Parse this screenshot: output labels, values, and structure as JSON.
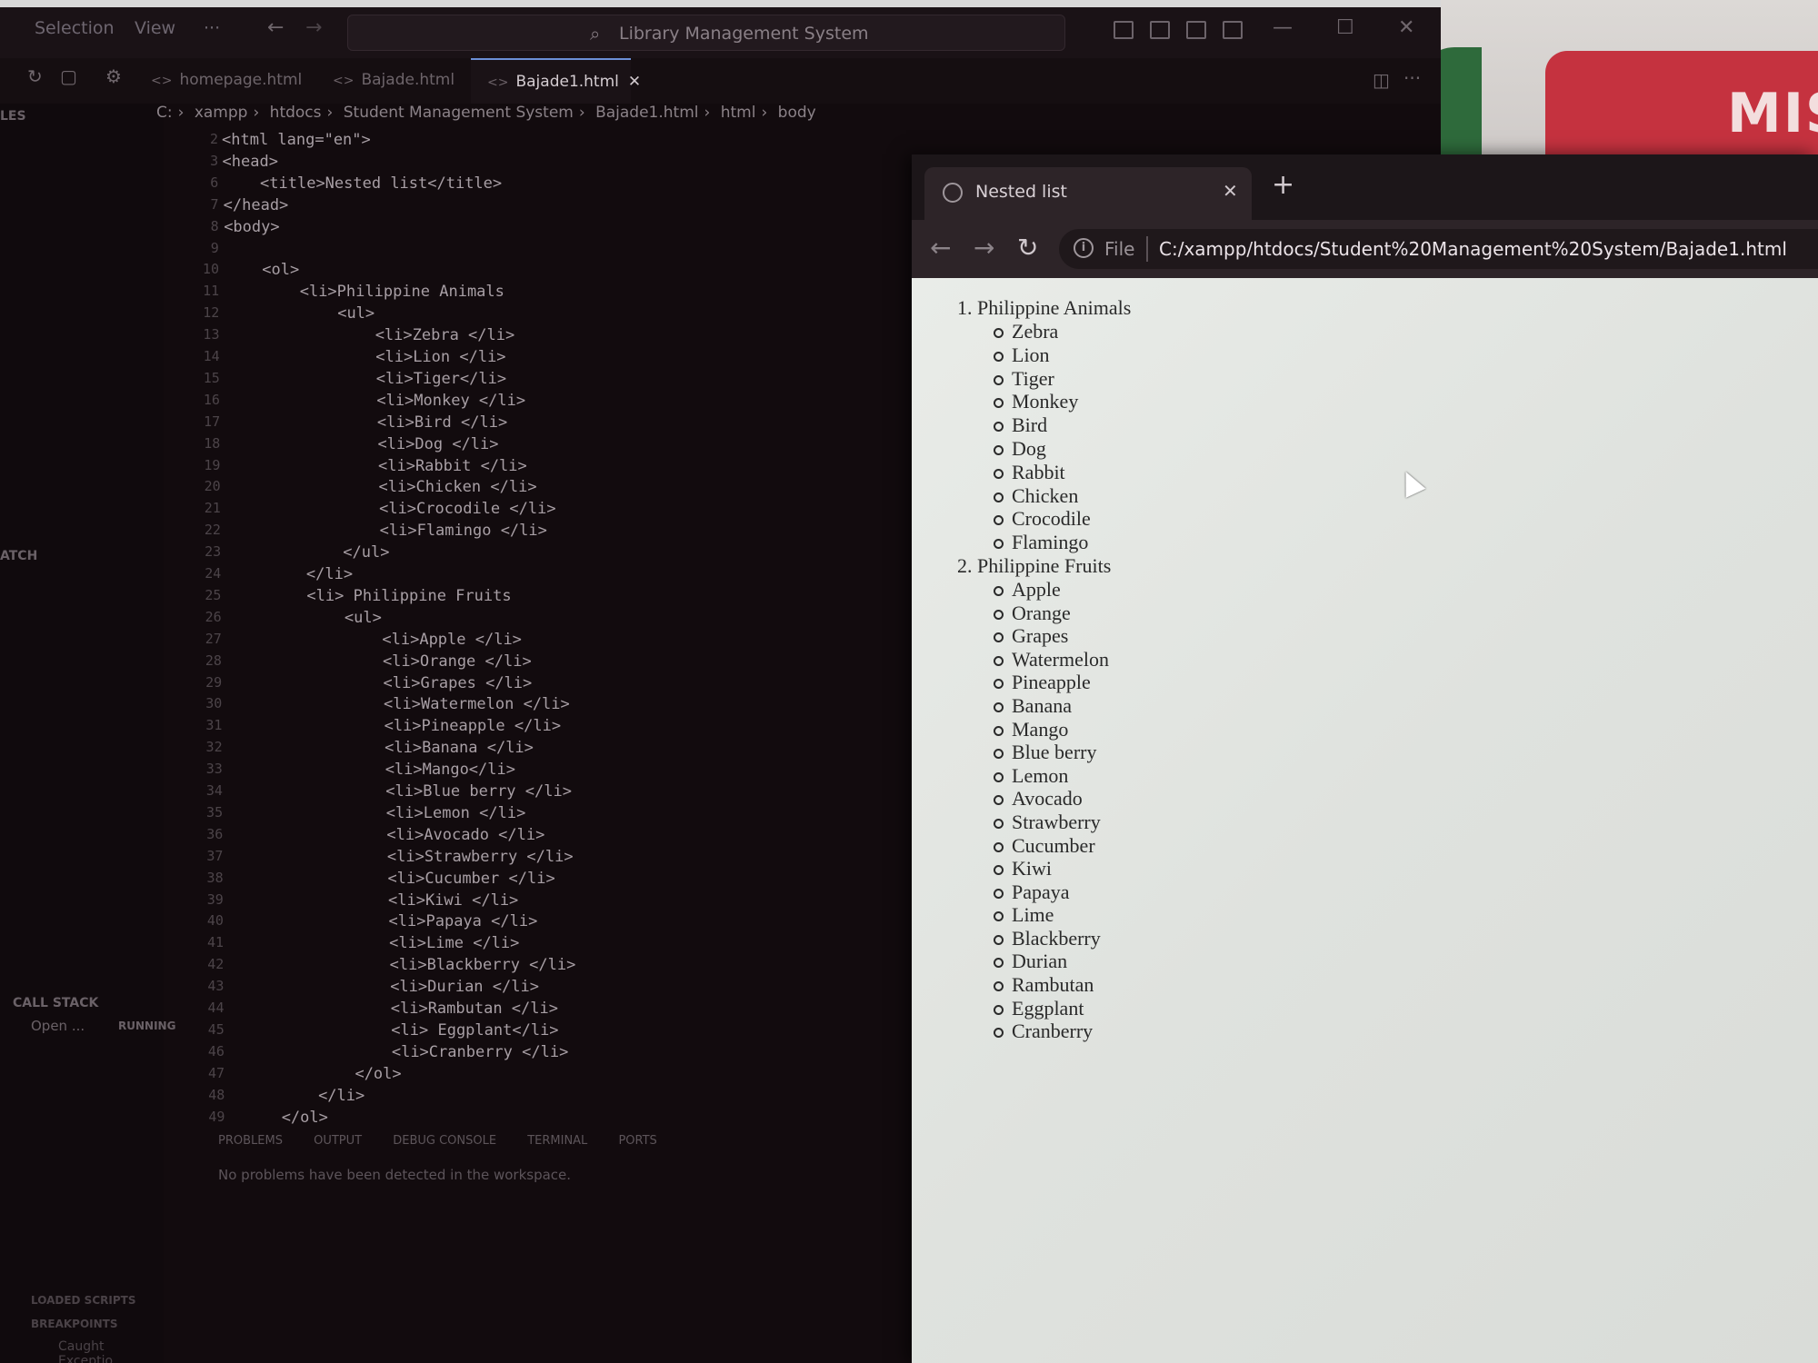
{
  "vscode": {
    "menu": [
      "Selection",
      "View",
      "···"
    ],
    "command_center": "Library Management System",
    "tabs": [
      {
        "label": "homepage.html"
      },
      {
        "label": "Bajade.html"
      },
      {
        "label": "Bajade1.html",
        "active": true
      }
    ],
    "breadcrumb": [
      "C:",
      "xampp",
      "htdocs",
      "Student Management System",
      "Bajade1.html",
      "html",
      "body"
    ],
    "sidebar": {
      "files_label": "LES",
      "watch_label": "ATCH",
      "call_stack_label": "CALL STACK",
      "call_stack_item": "Open ...",
      "call_stack_status": "RUNNING",
      "loaded_scripts_label": "LOADED SCRIPTS",
      "breakpoints_label": "BREAKPOINTS",
      "breakpoint_item": "Caught Exceptio..."
    },
    "panel": {
      "tabs": [
        "PROBLEMS",
        "OUTPUT",
        "DEBUG CONSOLE",
        "TERMINAL",
        "PORTS"
      ],
      "message": "No problems have been detected in the workspace."
    },
    "code_lines": [
      {
        "n": "2",
        "text": "<html lang=\"en\">"
      },
      {
        "n": "3",
        "text": "<head>"
      },
      {
        "n": "6",
        "text": "    <title>Nested list</title>"
      },
      {
        "n": "7",
        "text": "</head>"
      },
      {
        "n": "8",
        "text": "<body>"
      },
      {
        "n": "9",
        "text": ""
      },
      {
        "n": "10",
        "text": "    <ol>"
      },
      {
        "n": "11",
        "text": "        <li>Philippine Animals"
      },
      {
        "n": "12",
        "text": "            <ul>"
      },
      {
        "n": "13",
        "text": "                <li>Zebra </li>"
      },
      {
        "n": "14",
        "text": "                <li>Lion </li>"
      },
      {
        "n": "15",
        "text": "                <li>Tiger</li>"
      },
      {
        "n": "16",
        "text": "                <li>Monkey </li>"
      },
      {
        "n": "17",
        "text": "                <li>Bird </li>"
      },
      {
        "n": "18",
        "text": "                <li>Dog </li>"
      },
      {
        "n": "19",
        "text": "                <li>Rabbit </li>"
      },
      {
        "n": "20",
        "text": "                <li>Chicken </li>"
      },
      {
        "n": "21",
        "text": "                <li>Crocodile </li>"
      },
      {
        "n": "22",
        "text": "                <li>Flamingo </li>"
      },
      {
        "n": "23",
        "text": "            </ul>"
      },
      {
        "n": "24",
        "text": "        </li>"
      },
      {
        "n": "25",
        "text": "        <li> Philippine Fruits"
      },
      {
        "n": "26",
        "text": "            <ul>"
      },
      {
        "n": "27",
        "text": "                <li>Apple </li>"
      },
      {
        "n": "28",
        "text": "                <li>Orange </li>"
      },
      {
        "n": "29",
        "text": "                <li>Grapes </li>"
      },
      {
        "n": "30",
        "text": "                <li>Watermelon </li>"
      },
      {
        "n": "31",
        "text": "                <li>Pineapple </li>"
      },
      {
        "n": "32",
        "text": "                <li>Banana </li>"
      },
      {
        "n": "33",
        "text": "                <li>Mango</li>"
      },
      {
        "n": "34",
        "text": "                <li>Blue berry </li>"
      },
      {
        "n": "35",
        "text": "                <li>Lemon </li>"
      },
      {
        "n": "36",
        "text": "                <li>Avocado </li>"
      },
      {
        "n": "37",
        "text": "                <li>Strawberry </li>"
      },
      {
        "n": "38",
        "text": "                <li>Cucumber </li>"
      },
      {
        "n": "39",
        "text": "                <li>Kiwi </li>"
      },
      {
        "n": "40",
        "text": "                <li>Papaya </li>"
      },
      {
        "n": "41",
        "text": "                <li>Lime </li>"
      },
      {
        "n": "42",
        "text": "                <li>Blackberry </li>"
      },
      {
        "n": "43",
        "text": "                <li>Durian </li>"
      },
      {
        "n": "44",
        "text": "                <li>Rambutan </li>"
      },
      {
        "n": "45",
        "text": "                <li> Eggplant</li>"
      },
      {
        "n": "46",
        "text": "                <li>Cranberry </li>"
      },
      {
        "n": "47",
        "text": "            </ol>"
      },
      {
        "n": "48",
        "text": "        </li>"
      },
      {
        "n": "49",
        "text": "    </ol>"
      }
    ]
  },
  "background_tile_text": "MIS",
  "browser": {
    "tab_title": "Nested list",
    "address_prefix": "File",
    "url": "C:/xampp/htdocs/Student%20Management%20System/Bajade1.html",
    "content": {
      "lists": [
        {
          "heading": "1. Philippine Animals",
          "items": [
            "Zebra",
            "Lion",
            "Tiger",
            "Monkey",
            "Bird",
            "Dog",
            "Rabbit",
            "Chicken",
            "Crocodile",
            "Flamingo"
          ]
        },
        {
          "heading": "2. Philippine Fruits",
          "items": [
            "Apple",
            "Orange",
            "Grapes",
            "Watermelon",
            "Pineapple",
            "Banana",
            "Mango",
            "Blue berry",
            "Lemon",
            "Avocado",
            "Strawberry",
            "Cucumber",
            "Kiwi",
            "Papaya",
            "Lime",
            "Blackberry",
            "Durian",
            "Rambutan",
            "Eggplant",
            "Cranberry"
          ]
        }
      ]
    }
  },
  "colors": {
    "editor_bg": "#120b0e",
    "browser_page_bg": "#e4e6e3",
    "active_tab_accent": "#6b8fd6",
    "red_tile": "#c5323f",
    "green_tile": "#2e6a3b"
  }
}
